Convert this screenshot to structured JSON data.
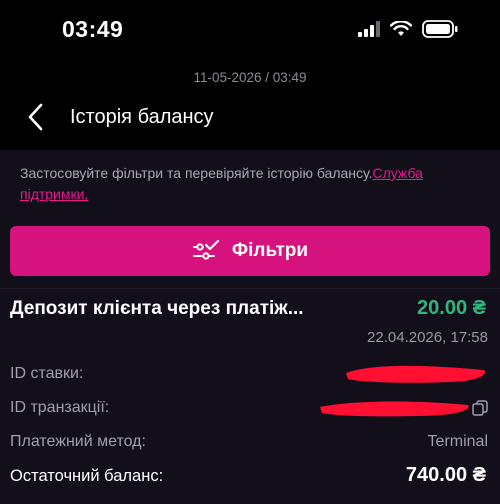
{
  "status_bar": {
    "time": "03:49"
  },
  "header": {
    "date": "11-05-2026 / 03:49",
    "title": "Історія балансу"
  },
  "info": {
    "text": "Застосовуйте фільтри та перевіряйте історію балансу.",
    "support_link": "Служба підтримки."
  },
  "filters_button": {
    "label": "Фільтри"
  },
  "transaction": {
    "title": "Депозит клієнта через платіж...",
    "amount": "20.00 ₴",
    "date": "22.04.2026, 17:58",
    "rows": {
      "bet_id_label": "ID ставки:",
      "transaction_id_label": "ID транзакції:",
      "payment_method_label": "Платежний метод:",
      "payment_method_value": "Terminal",
      "final_balance_label": "Остаточний баланс:",
      "final_balance_value": "740.00 ₴"
    }
  },
  "colors": {
    "background": "#120f1b",
    "accent": "#d6127e",
    "amount_positive": "#2fb67a",
    "link": "#e61a8c"
  }
}
